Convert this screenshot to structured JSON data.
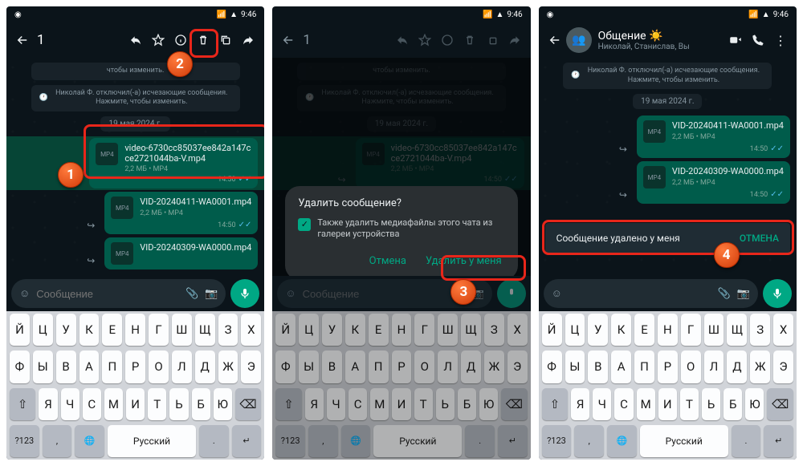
{
  "status": {
    "time": "9:46"
  },
  "p1": {
    "selected_count": "1",
    "sys1": "чтобы изменить.",
    "sys2": "Николай Ф. отключил(-а) исчезающие сообщения. Нажмите, чтобы изменить.",
    "date": "19 мая 2024 г.",
    "msgs": [
      {
        "name": "video-6730cc85037ee842a147cce2721044ba-V.mp4",
        "meta": "2,2 МБ • MP4",
        "time": "14:50"
      },
      {
        "name": "VID-20240411-WA0001.mp4",
        "meta": "2,2 МБ • MP4",
        "time": "14:50"
      },
      {
        "name": "VID-20240309-WA0000.mp4",
        "meta": "",
        "time": ""
      }
    ],
    "input_placeholder": "Сообщение"
  },
  "p2": {
    "dlg_title": "Удалить сообщение?",
    "dlg_check": "Также удалить медиафайлы этого чата из галереи устройства",
    "dlg_cancel": "Отмена",
    "dlg_delete": "Удалить у меня"
  },
  "p3": {
    "chat_title": "Общение ☀️",
    "chat_sub": "Николай, Станислав, Вы",
    "msgs": [
      {
        "name": "VID-20240411-WA0001.mp4",
        "meta": "2,2 МБ • MP4",
        "time": "14:50"
      },
      {
        "name": "VID-20240309-WA0000.mp4",
        "meta": "2,2 МБ • MP4",
        "time": "14:50"
      }
    ],
    "snack_text": "Сообщение удалено у меня",
    "snack_action": "ОТМЕНА"
  },
  "kb": {
    "r1": [
      "Й",
      "Ц",
      "У",
      "К",
      "Е",
      "Н",
      "Г",
      "Ш",
      "Щ",
      "З",
      "Х"
    ],
    "r2": [
      "Ф",
      "Ы",
      "В",
      "А",
      "П",
      "Р",
      "О",
      "Л",
      "Д",
      "Ж",
      "Э"
    ],
    "r3": [
      "Я",
      "Ч",
      "С",
      "М",
      "И",
      "Т",
      "Ь",
      "Б",
      "Ю"
    ],
    "lang": "Русский",
    "numkey": "?123"
  }
}
